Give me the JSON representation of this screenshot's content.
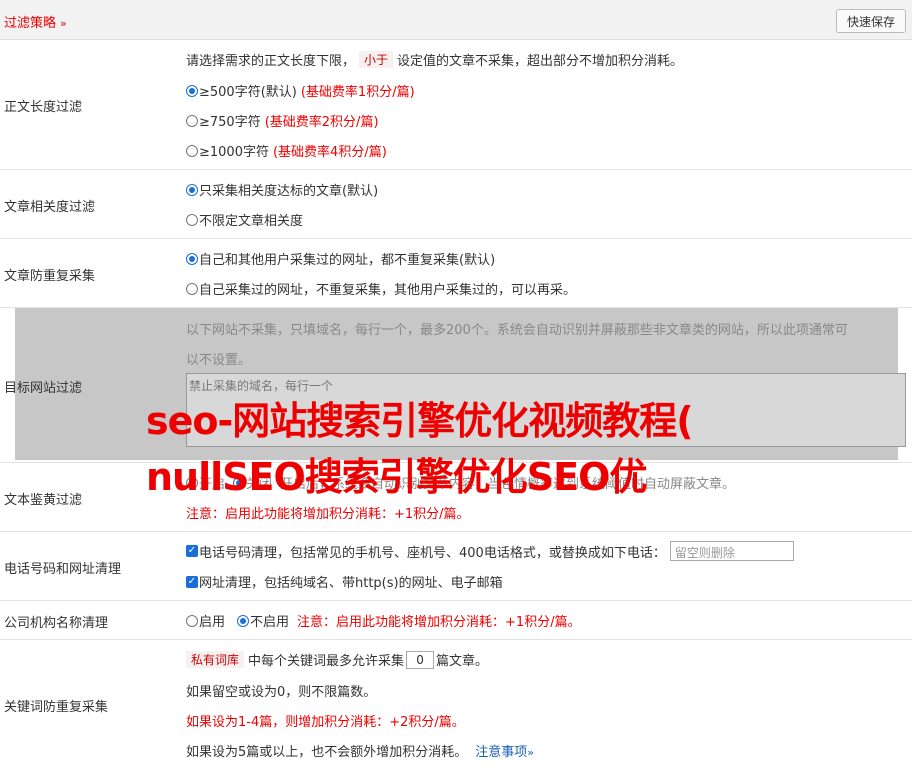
{
  "header": {
    "title": "过滤策略",
    "chevron": "»",
    "save_label": "快速保存"
  },
  "length_filter": {
    "label": "正文长度过滤",
    "desc_pre": "请选择需求的正文长度下限，",
    "desc_tag": "小于",
    "desc_post": "设定值的文章不采集，超出部分不增加积分消耗。",
    "options": [
      {
        "text": "≥500字符(默认)",
        "note": "(基础费率1积分/篇)",
        "checked": true
      },
      {
        "text": "≥750字符",
        "note": "(基础费率2积分/篇)",
        "checked": false
      },
      {
        "text": "≥1000字符",
        "note": "(基础费率4积分/篇)",
        "checked": false
      }
    ]
  },
  "relevance_filter": {
    "label": "文章相关度过滤",
    "options": [
      "只采集相关度达标的文章(默认)",
      "不限定文章相关度"
    ]
  },
  "dedupe": {
    "label": "文章防重复采集",
    "options": [
      "自己和其他用户采集过的网址，都不重复采集(默认)",
      "自己采集过的网址，不重复采集，其他用户采集过的，可以再采。"
    ]
  },
  "target_site": {
    "label": "目标网站过滤",
    "desc_line1": "以下网站不采集，只填域名，每行一个，最多200个。系统会自动识别并屏蔽那些非文章类的网站，所以此项通常可",
    "desc_line2": "以不设置。",
    "placeholder": "禁止采集的域名，每行一个"
  },
  "text_check": {
    "label": "文本鉴黄过滤",
    "line_on": "开启",
    "line_off": "关闭",
    "line_desc": "开启后，系统会自动识别文章内容，当色情概率达到系统阈值时自动屏蔽文章。",
    "note": "注意：启用此功能将增加积分消耗：+1积分/篇。"
  },
  "phone_clean": {
    "label": "电话号码和网址清理",
    "phone_text": "电话号码清理，包括常见的手机号、座机号、400电话格式，或替换成如下电话：",
    "phone_placeholder": "留空则删除",
    "url_text": "网址清理，包括纯域名、带http(s)的网址、电子邮箱"
  },
  "company_clean": {
    "label": "公司机构名称清理",
    "opt_on": "启用",
    "opt_off": "不启用",
    "note": "注意：启用此功能将增加积分消耗：+1积分/篇。"
  },
  "keyword_dedupe": {
    "label": "关键词防重复采集",
    "tag": "私有词库",
    "text_pre": "中每个关键词最多允许采集",
    "value": "0",
    "text_post": "篇文章。",
    "line2": "如果留空或设为0，则不限篇数。",
    "line3": "如果设为1-4篇，则增加积分消耗：+2积分/篇。",
    "line4": "如果设为5篇或以上，也不会额外增加积分消耗。",
    "link": "注意事项",
    "link_chevron": "»"
  },
  "watermark": {
    "line1": "seo-网站搜索引擎优化视频教程(",
    "line2": "nullSEO搜索引擎优化SEO优"
  },
  "colors": {
    "accent": "#1a6ed8",
    "warning": "#ee0000",
    "overlay": "#c7c7c7"
  }
}
